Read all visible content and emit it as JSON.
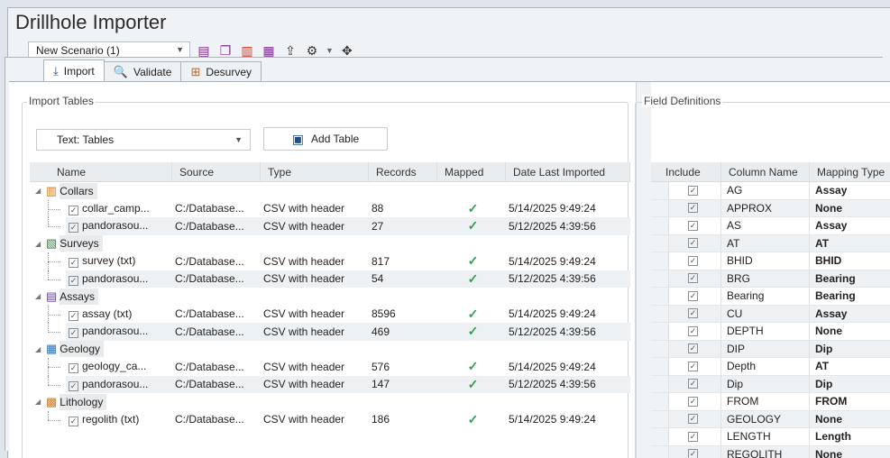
{
  "app": {
    "title": "Drillhole Importer"
  },
  "toolbar": {
    "scenario_value": "New Scenario (1)",
    "icons": [
      "add-scenario-icon",
      "copy-scenario-icon",
      "delete-scenario-icon",
      "scenario-settings-icon",
      "export-icon",
      "filter-icon",
      "dropdown-arrow-icon",
      "fit-icon"
    ]
  },
  "tabs": [
    {
      "label": "Import",
      "icon": "import-icon",
      "active": true
    },
    {
      "label": "Validate",
      "icon": "validate-icon",
      "active": false
    },
    {
      "label": "Desurvey",
      "icon": "desurvey-icon",
      "active": false
    }
  ],
  "import_tables": {
    "group_label": "Import Tables",
    "source_select": "Text: Tables",
    "add_table_label": "Add Table",
    "columns": [
      "Name",
      "Source",
      "Type",
      "Records",
      "Mapped",
      "Date Last Imported"
    ],
    "groups": [
      {
        "name": "Collars",
        "icon": "collars-icon",
        "rows": [
          {
            "name": "collar_camp...",
            "source": "C:/Database...",
            "type": "CSV with header",
            "records": "88",
            "mapped": "✓",
            "date": "5/14/2025 9:49:24"
          },
          {
            "name": "pandorasou...",
            "source": "C:/Database...",
            "type": "CSV with header",
            "records": "27",
            "mapped": "✓",
            "date": "5/12/2025 4:39:56"
          }
        ]
      },
      {
        "name": "Surveys",
        "icon": "surveys-icon",
        "rows": [
          {
            "name": "survey (txt)",
            "source": "C:/Database...",
            "type": "CSV with header",
            "records": "817",
            "mapped": "✓",
            "date": "5/14/2025 9:49:24"
          },
          {
            "name": "pandorasou...",
            "source": "C:/Database...",
            "type": "CSV with header",
            "records": "54",
            "mapped": "✓",
            "date": "5/12/2025 4:39:56"
          }
        ]
      },
      {
        "name": "Assays",
        "icon": "assays-icon",
        "rows": [
          {
            "name": "assay (txt)",
            "source": "C:/Database...",
            "type": "CSV with header",
            "records": "8596",
            "mapped": "✓",
            "date": "5/14/2025 9:49:24"
          },
          {
            "name": "pandorasou...",
            "source": "C:/Database...",
            "type": "CSV with header",
            "records": "469",
            "mapped": "✓",
            "date": "5/12/2025 4:39:56"
          }
        ]
      },
      {
        "name": "Geology",
        "icon": "geology-icon",
        "rows": [
          {
            "name": "geology_ca...",
            "source": "C:/Database...",
            "type": "CSV with header",
            "records": "576",
            "mapped": "✓",
            "date": "5/14/2025 9:49:24"
          },
          {
            "name": "pandorasou...",
            "source": "C:/Database...",
            "type": "CSV with header",
            "records": "147",
            "mapped": "✓",
            "date": "5/12/2025 4:39:56"
          }
        ]
      },
      {
        "name": "Lithology",
        "icon": "lithology-icon",
        "rows": [
          {
            "name": "regolith (txt)",
            "source": "C:/Database...",
            "type": "CSV with header",
            "records": "186",
            "mapped": "✓",
            "date": "5/14/2025 9:49:24"
          }
        ]
      }
    ]
  },
  "field_definitions": {
    "group_label": "Field Definitions",
    "columns": [
      "Include",
      "Column Name",
      "Mapping Type"
    ],
    "rows": [
      {
        "include": "✓",
        "column": "AG",
        "mapping": "Assay"
      },
      {
        "include": "✓",
        "column": "APPROX",
        "mapping": "None"
      },
      {
        "include": "✓",
        "column": "AS",
        "mapping": "Assay"
      },
      {
        "include": "✓",
        "column": "AT",
        "mapping": "AT"
      },
      {
        "include": "✓",
        "column": "BHID",
        "mapping": "BHID"
      },
      {
        "include": "✓",
        "column": "BRG",
        "mapping": "Bearing"
      },
      {
        "include": "✓",
        "column": "Bearing",
        "mapping": "Bearing"
      },
      {
        "include": "✓",
        "column": "CU",
        "mapping": "Assay"
      },
      {
        "include": "✓",
        "column": "DEPTH",
        "mapping": "None"
      },
      {
        "include": "✓",
        "column": "DIP",
        "mapping": "Dip"
      },
      {
        "include": "✓",
        "column": "Depth",
        "mapping": "AT"
      },
      {
        "include": "✓",
        "column": "Dip",
        "mapping": "Dip"
      },
      {
        "include": "✓",
        "column": "FROM",
        "mapping": "FROM"
      },
      {
        "include": "✓",
        "column": "GEOLOGY",
        "mapping": "None"
      },
      {
        "include": "✓",
        "column": "LENGTH",
        "mapping": "Length"
      },
      {
        "include": "✓",
        "column": "REGOLITH",
        "mapping": "None"
      }
    ]
  }
}
